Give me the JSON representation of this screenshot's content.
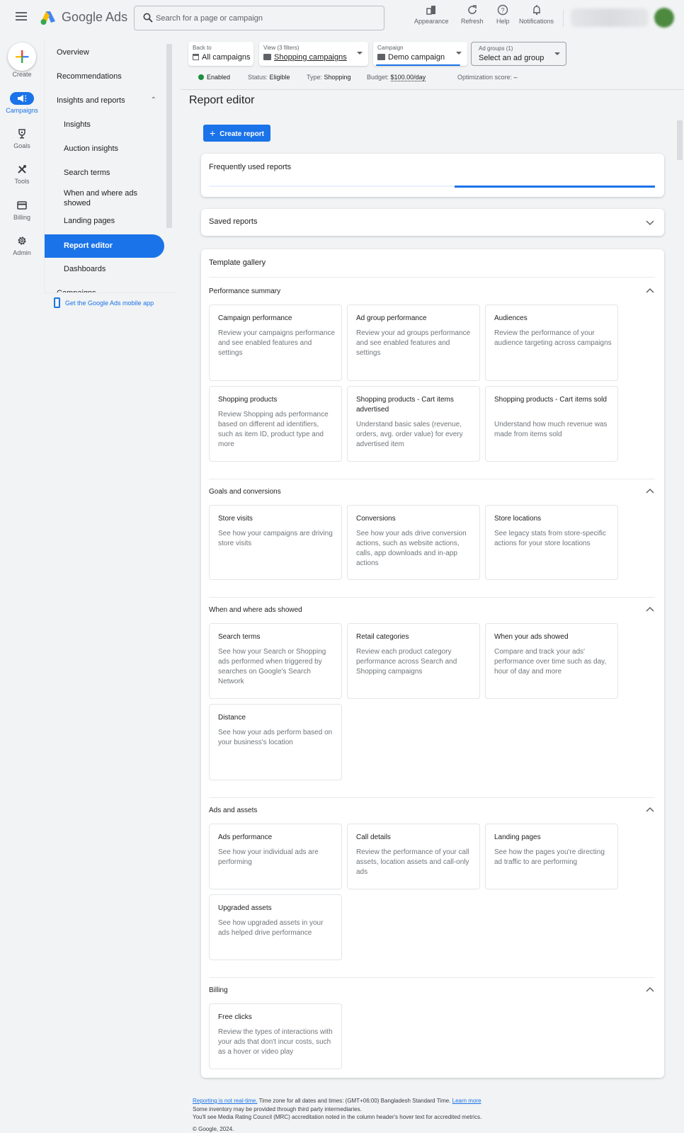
{
  "topbar": {
    "brand": "Google Ads",
    "search_placeholder": "Search for a page or campaign",
    "buttons": [
      {
        "label": "Appearance",
        "icon": "appearance-icon"
      },
      {
        "label": "Refresh",
        "icon": "refresh-icon"
      },
      {
        "label": "Help",
        "icon": "help-icon"
      },
      {
        "label": "Notifications",
        "icon": "bell-icon"
      }
    ]
  },
  "rail": {
    "create_label": "Create",
    "items": [
      {
        "label": "Campaigns",
        "icon": "megaphone-icon",
        "active": true
      },
      {
        "label": "Goals",
        "icon": "trophy-icon"
      },
      {
        "label": "Tools",
        "icon": "tools-icon"
      },
      {
        "label": "Billing",
        "icon": "credit-card-icon"
      },
      {
        "label": "Admin",
        "icon": "gear-icon"
      }
    ]
  },
  "nav": {
    "items": [
      {
        "label": "Overview"
      },
      {
        "label": "Recommendations"
      },
      {
        "label": "Insights and reports",
        "expanded": true
      },
      {
        "label": "Insights"
      },
      {
        "label": "Auction insights"
      },
      {
        "label": "Search terms"
      },
      {
        "label": "When and where ads showed"
      },
      {
        "label": "Landing pages"
      },
      {
        "label": "Report editor",
        "active": true
      },
      {
        "label": "Dashboards"
      },
      {
        "label": "Campaigns",
        "expanded": false
      }
    ],
    "mobile_app": "Get the Google Ads mobile app"
  },
  "header": {
    "back": {
      "label": "Back to",
      "value": "All campaigns"
    },
    "view": {
      "label": "View (3 filters)",
      "value": "Shopping campaigns"
    },
    "campaign": {
      "label": "Campaign",
      "value": "Demo campaign"
    },
    "ad_groups": {
      "label": "Ad groups (1)",
      "value": "Select an ad group"
    },
    "status": {
      "state": "Enabled",
      "status_label": "Status:",
      "status_value": "Eligible",
      "type_label": "Type:",
      "type_value": "Shopping",
      "budget_label": "Budget:",
      "budget_value": "$100.00/day",
      "opt_label": "Optimization score:",
      "opt_value": "–"
    },
    "colors": {
      "enabled": "#1e8e3e",
      "accent": "#1a73e8"
    }
  },
  "main": {
    "title": "Report editor",
    "create_report": "Create report",
    "frequently_used": {
      "title": "Frequently used reports",
      "progress_start": 0.55,
      "progress_end": 1.0
    },
    "saved_reports": "Saved reports",
    "gallery": {
      "title": "Template gallery",
      "sections": [
        {
          "title": "Performance summary",
          "templates": [
            {
              "title": "Campaign performance",
              "desc": "Review your campaigns performance and see enabled features and settings"
            },
            {
              "title": "Ad group performance",
              "desc": "Review your ad groups performance and see enabled features and settings"
            },
            {
              "title": "Audiences",
              "desc": "Review the performance of your audience targeting across campaigns"
            },
            {
              "title": "Shopping products",
              "desc": "Review Shopping ads performance based on different ad identifiers, such as item ID, product type and more"
            },
            {
              "title": "Shopping products - Cart items advertised",
              "desc": "Understand basic sales (revenue, orders, avg. order value) for every advertised item"
            },
            {
              "title": "Shopping products - Cart items sold",
              "desc": "Understand how much revenue was made from items sold"
            }
          ]
        },
        {
          "title": "Goals and conversions",
          "templates": [
            {
              "title": "Store visits",
              "desc": "See how your campaigns are driving store visits"
            },
            {
              "title": "Conversions",
              "desc": "See how your ads drive conversion actions, such as website actions, calls, app downloads and in-app actions"
            },
            {
              "title": "Store locations",
              "desc": "See legacy stats from store-specific actions for your store locations"
            }
          ]
        },
        {
          "title": "When and where ads showed",
          "templates": [
            {
              "title": "Search terms",
              "desc": "See how your Search or Shopping ads performed when triggered by searches on Google's Search Network"
            },
            {
              "title": "Retail categories",
              "desc": "Review each product category performance across Search and Shopping campaigns"
            },
            {
              "title": "When your ads showed",
              "desc": "Compare and track your ads' performance over time such as day, hour of day and more"
            },
            {
              "title": "Distance",
              "desc": "See how your ads perform based on your business's location"
            }
          ]
        },
        {
          "title": "Ads and assets",
          "templates": [
            {
              "title": "Ads performance",
              "desc": "See how your individual ads are performing"
            },
            {
              "title": "Call details",
              "desc": "Review the performance of your call assets, location assets and call-only ads"
            },
            {
              "title": "Landing pages",
              "desc": "See how the pages you're directing ad traffic to are performing"
            },
            {
              "title": "Upgraded assets",
              "desc": "See how upgraded assets in your ads helped drive performance"
            }
          ]
        },
        {
          "title": "Billing",
          "templates": [
            {
              "title": "Free clicks",
              "desc": "Review the types of interactions with your ads that don't incur costs, such as a hover or video play"
            }
          ]
        }
      ]
    }
  },
  "footer": {
    "reporting_link": "Reporting is not real-time.",
    "timezone": " Time zone for all dates and times: (GMT+06:00) Bangladesh Standard Time. ",
    "learn_more": "Learn more",
    "line2": "Some inventory may be provided through third party intermediaries.",
    "line3": "You'll see Media Rating Council (MRC) accreditation noted in the column header's hover text for accredited metrics.",
    "copyright": "© Google, 2024."
  }
}
